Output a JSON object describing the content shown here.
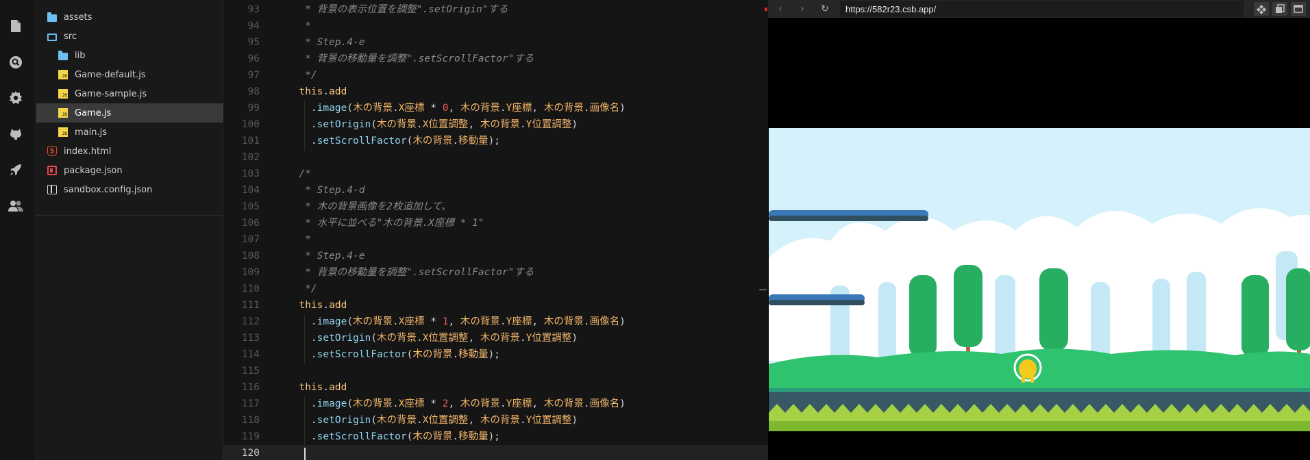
{
  "activity_bar": {
    "items": [
      {
        "name": "files-icon",
        "glyph": "file"
      },
      {
        "name": "search-icon",
        "glyph": "search"
      },
      {
        "name": "settings-icon",
        "glyph": "gear"
      },
      {
        "name": "github-icon",
        "glyph": "github"
      },
      {
        "name": "deploy-icon",
        "glyph": "rocket"
      },
      {
        "name": "users-icon",
        "glyph": "users"
      }
    ]
  },
  "explorer": {
    "items": [
      {
        "label": "assets",
        "icon": "folder-icon",
        "depth": 1,
        "active": false
      },
      {
        "label": "src",
        "icon": "folder-open-icon",
        "depth": 1,
        "active": false
      },
      {
        "label": "lib",
        "icon": "folder-icon",
        "depth": 2,
        "active": false
      },
      {
        "label": "Game-default.js",
        "icon": "js-file-icon",
        "depth": 2,
        "active": false
      },
      {
        "label": "Game-sample.js",
        "icon": "js-file-icon",
        "depth": 2,
        "active": false
      },
      {
        "label": "Game.js",
        "icon": "js-file-icon",
        "depth": 2,
        "active": true
      },
      {
        "label": "main.js",
        "icon": "js-file-icon",
        "depth": 2,
        "active": false
      },
      {
        "label": "index.html",
        "icon": "html-file-icon",
        "depth": 1,
        "active": false
      },
      {
        "label": "package.json",
        "icon": "package-json-icon",
        "depth": 1,
        "active": false
      },
      {
        "label": "sandbox.config.json",
        "icon": "sandbox-config-icon",
        "depth": 1,
        "active": false
      }
    ]
  },
  "editor": {
    "current_line": 120,
    "lines": [
      {
        "n": 93,
        "tokens": [
          [
            "comment",
            "   * 背景の表示位置を調整\".setOrigin\"する"
          ]
        ]
      },
      {
        "n": 94,
        "tokens": [
          [
            "comment",
            "   *"
          ]
        ]
      },
      {
        "n": 95,
        "tokens": [
          [
            "comment",
            "   * Step.4-e"
          ]
        ]
      },
      {
        "n": 96,
        "tokens": [
          [
            "comment",
            "   * 背景の移動量を調整\".setScrollFactor\"する"
          ]
        ]
      },
      {
        "n": 97,
        "tokens": [
          [
            "comment",
            "   */"
          ]
        ]
      },
      {
        "n": 98,
        "tokens": [
          [
            "punc",
            "  "
          ],
          [
            "kw",
            "this"
          ],
          [
            "punc",
            "."
          ],
          [
            "kw",
            "add"
          ]
        ]
      },
      {
        "n": 99,
        "tokens": [
          [
            "punc",
            "    ."
          ],
          [
            "method",
            "image"
          ],
          [
            "punc",
            "("
          ],
          [
            "ident",
            "木の背景"
          ],
          [
            "punc",
            "."
          ],
          [
            "ident",
            "X座標"
          ],
          [
            "punc",
            " * "
          ],
          [
            "num",
            "0"
          ],
          [
            "punc",
            ", "
          ],
          [
            "ident",
            "木の背景"
          ],
          [
            "punc",
            "."
          ],
          [
            "ident",
            "Y座標"
          ],
          [
            "punc",
            ", "
          ],
          [
            "ident",
            "木の背景"
          ],
          [
            "punc",
            "."
          ],
          [
            "ident",
            "画像名"
          ],
          [
            "punc",
            ")"
          ]
        ]
      },
      {
        "n": 100,
        "tokens": [
          [
            "punc",
            "    ."
          ],
          [
            "method",
            "setOrigin"
          ],
          [
            "punc",
            "("
          ],
          [
            "ident",
            "木の背景"
          ],
          [
            "punc",
            "."
          ],
          [
            "ident",
            "X位置調整"
          ],
          [
            "punc",
            ", "
          ],
          [
            "ident",
            "木の背景"
          ],
          [
            "punc",
            "."
          ],
          [
            "ident",
            "Y位置調整"
          ],
          [
            "punc",
            ")"
          ]
        ]
      },
      {
        "n": 101,
        "tokens": [
          [
            "punc",
            "    ."
          ],
          [
            "method",
            "setScrollFactor"
          ],
          [
            "punc",
            "("
          ],
          [
            "ident",
            "木の背景"
          ],
          [
            "punc",
            "."
          ],
          [
            "ident",
            "移動量"
          ],
          [
            "punc",
            ");"
          ]
        ]
      },
      {
        "n": 102,
        "tokens": []
      },
      {
        "n": 103,
        "tokens": [
          [
            "comment",
            "  /*"
          ]
        ]
      },
      {
        "n": 104,
        "tokens": [
          [
            "comment",
            "   * Step.4-d"
          ]
        ]
      },
      {
        "n": 105,
        "tokens": [
          [
            "comment",
            "   * 木の背景画像を2枚追加して、"
          ]
        ]
      },
      {
        "n": 106,
        "tokens": [
          [
            "comment",
            "   * 水平に並べる\"木の背景.X座標 * 1\""
          ]
        ]
      },
      {
        "n": 107,
        "tokens": [
          [
            "comment",
            "   *"
          ]
        ]
      },
      {
        "n": 108,
        "tokens": [
          [
            "comment",
            "   * Step.4-e"
          ]
        ]
      },
      {
        "n": 109,
        "tokens": [
          [
            "comment",
            "   * 背景の移動量を調整\".setScrollFactor\"する"
          ]
        ]
      },
      {
        "n": 110,
        "tokens": [
          [
            "comment",
            "   */"
          ]
        ]
      },
      {
        "n": 111,
        "tokens": [
          [
            "punc",
            "  "
          ],
          [
            "kw",
            "this"
          ],
          [
            "punc",
            "."
          ],
          [
            "kw",
            "add"
          ]
        ]
      },
      {
        "n": 112,
        "tokens": [
          [
            "punc",
            "    ."
          ],
          [
            "method",
            "image"
          ],
          [
            "punc",
            "("
          ],
          [
            "ident",
            "木の背景"
          ],
          [
            "punc",
            "."
          ],
          [
            "ident",
            "X座標"
          ],
          [
            "punc",
            " * "
          ],
          [
            "num",
            "1"
          ],
          [
            "punc",
            ", "
          ],
          [
            "ident",
            "木の背景"
          ],
          [
            "punc",
            "."
          ],
          [
            "ident",
            "Y座標"
          ],
          [
            "punc",
            ", "
          ],
          [
            "ident",
            "木の背景"
          ],
          [
            "punc",
            "."
          ],
          [
            "ident",
            "画像名"
          ],
          [
            "punc",
            ")"
          ]
        ]
      },
      {
        "n": 113,
        "tokens": [
          [
            "punc",
            "    ."
          ],
          [
            "method",
            "setOrigin"
          ],
          [
            "punc",
            "("
          ],
          [
            "ident",
            "木の背景"
          ],
          [
            "punc",
            "."
          ],
          [
            "ident",
            "X位置調整"
          ],
          [
            "punc",
            ", "
          ],
          [
            "ident",
            "木の背景"
          ],
          [
            "punc",
            "."
          ],
          [
            "ident",
            "Y位置調整"
          ],
          [
            "punc",
            ")"
          ]
        ]
      },
      {
        "n": 114,
        "tokens": [
          [
            "punc",
            "    ."
          ],
          [
            "method",
            "setScrollFactor"
          ],
          [
            "punc",
            "("
          ],
          [
            "ident",
            "木の背景"
          ],
          [
            "punc",
            "."
          ],
          [
            "ident",
            "移動量"
          ],
          [
            "punc",
            ");"
          ]
        ]
      },
      {
        "n": 115,
        "tokens": []
      },
      {
        "n": 116,
        "tokens": [
          [
            "punc",
            "  "
          ],
          [
            "kw",
            "this"
          ],
          [
            "punc",
            "."
          ],
          [
            "kw",
            "add"
          ]
        ]
      },
      {
        "n": 117,
        "tokens": [
          [
            "punc",
            "    ."
          ],
          [
            "method",
            "image"
          ],
          [
            "punc",
            "("
          ],
          [
            "ident",
            "木の背景"
          ],
          [
            "punc",
            "."
          ],
          [
            "ident",
            "X座標"
          ],
          [
            "punc",
            " * "
          ],
          [
            "num",
            "2"
          ],
          [
            "punc",
            ", "
          ],
          [
            "ident",
            "木の背景"
          ],
          [
            "punc",
            "."
          ],
          [
            "ident",
            "Y座標"
          ],
          [
            "punc",
            ", "
          ],
          [
            "ident",
            "木の背景"
          ],
          [
            "punc",
            "."
          ],
          [
            "ident",
            "画像名"
          ],
          [
            "punc",
            ")"
          ]
        ]
      },
      {
        "n": 118,
        "tokens": [
          [
            "punc",
            "    ."
          ],
          [
            "method",
            "setOrigin"
          ],
          [
            "punc",
            "("
          ],
          [
            "ident",
            "木の背景"
          ],
          [
            "punc",
            "."
          ],
          [
            "ident",
            "X位置調整"
          ],
          [
            "punc",
            ", "
          ],
          [
            "ident",
            "木の背景"
          ],
          [
            "punc",
            "."
          ],
          [
            "ident",
            "Y位置調整"
          ],
          [
            "punc",
            ")"
          ]
        ]
      },
      {
        "n": 119,
        "tokens": [
          [
            "punc",
            "    ."
          ],
          [
            "method",
            "setScrollFactor"
          ],
          [
            "punc",
            "("
          ],
          [
            "ident",
            "木の背景"
          ],
          [
            "punc",
            "."
          ],
          [
            "ident",
            "移動量"
          ],
          [
            "punc",
            ");"
          ]
        ]
      },
      {
        "n": 120,
        "tokens": []
      }
    ]
  },
  "preview": {
    "url": "https://582r23.csb.app/",
    "nav": {
      "back": "‹",
      "forward": "›",
      "refresh": "↻"
    },
    "tools": [
      "split-view-icon",
      "copy-icon",
      "open-window-icon"
    ]
  },
  "colors": {
    "sky": "#d5f1fb",
    "cloud": "#ffffff",
    "tree_ghost": "#c4e8f6",
    "tree_green": "#27ae60",
    "trunk": "#b7613c",
    "grass": "#2fc26f",
    "dirt": "#395866",
    "zigzag": "#a6d144",
    "platform": "#3a78b6",
    "player": "#f7c81e"
  }
}
